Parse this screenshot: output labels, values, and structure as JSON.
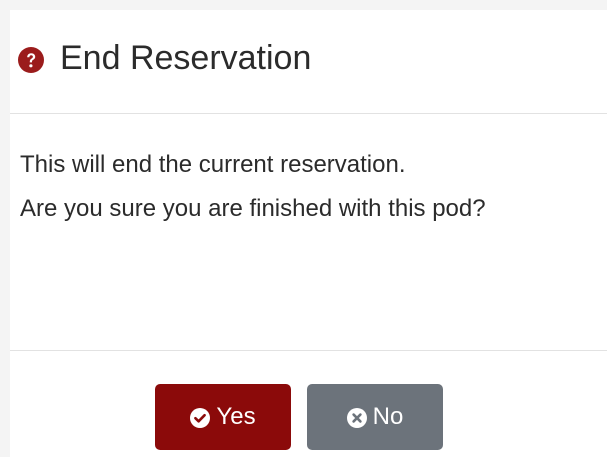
{
  "dialog": {
    "title": "End Reservation",
    "title_icon": "question-circle-icon",
    "accent_color": "#9b1c1c",
    "body": {
      "line1": "This will end the current reservation.",
      "line2": "Are you sure you are finished with this pod?"
    },
    "buttons": {
      "yes": {
        "label": "Yes",
        "icon": "check-circle-icon",
        "color": "#8b0a0a"
      },
      "no": {
        "label": "No",
        "icon": "x-circle-icon",
        "color": "#6c737b"
      }
    }
  }
}
